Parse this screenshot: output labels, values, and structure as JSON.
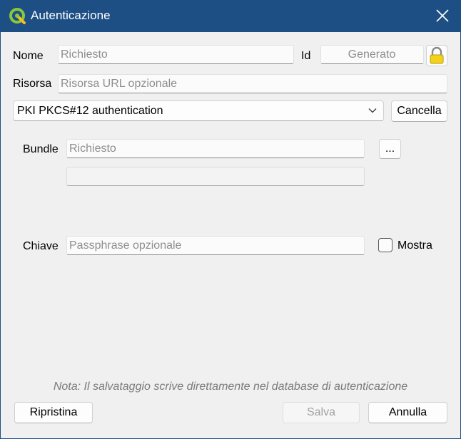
{
  "window": {
    "title": "Autenticazione",
    "app_icon": "qgis-icon",
    "accent_color": "#1e4f84"
  },
  "form": {
    "name_label": "Nome",
    "name_placeholder": "Richiesto",
    "id_label": "Id",
    "id_placeholder": "Generato",
    "lock_icon": "lock-icon",
    "resource_label": "Risorsa",
    "resource_placeholder": "Risorsa URL opzionale",
    "method_selected": "PKI PKCS#12 authentication",
    "clear_button": "Cancella"
  },
  "pkcs12": {
    "bundle_label": "Bundle",
    "bundle_placeholder": "Richiesto",
    "browse_button": "...",
    "key_label": "Chiave",
    "key_placeholder": "Passphrase opzionale",
    "show_label": "Mostra",
    "show_checked": false
  },
  "footer": {
    "note": "Nota: Il salvataggio scrive direttamente nel database di autenticazione",
    "reset_button": "Ripristina",
    "save_button": "Salva",
    "cancel_button": "Annulla"
  }
}
